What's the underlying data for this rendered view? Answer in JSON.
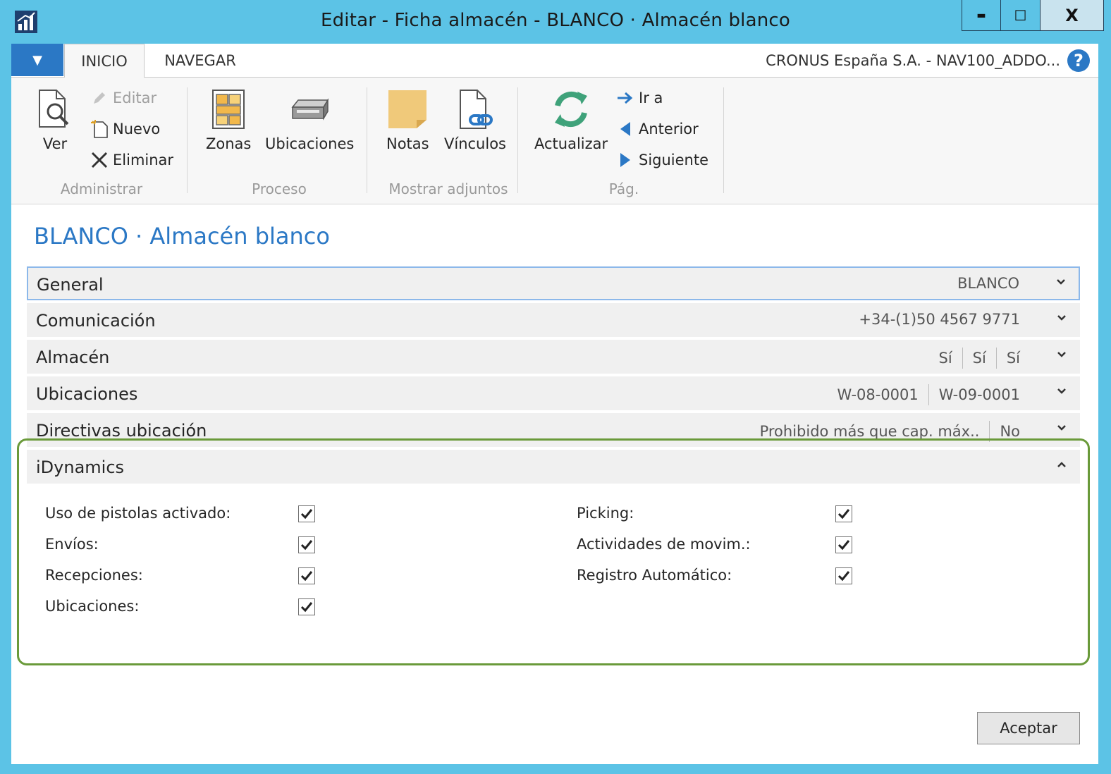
{
  "window": {
    "title": "Editar - Ficha almacén - BLANCO · Almacén blanco",
    "minimize_glyph": "▬",
    "maximize_glyph": "☐",
    "close_glyph": "X"
  },
  "tabs": {
    "file_glyph": "▼",
    "items": [
      {
        "label": "INICIO",
        "active": true
      },
      {
        "label": "NAVEGAR",
        "active": false
      }
    ],
    "company": "CRONUS España S.A. - NAV100_ADDO...",
    "help_glyph": "?"
  },
  "ribbon": {
    "groups": [
      {
        "label": "Administrar"
      },
      {
        "label": "Proceso"
      },
      {
        "label": "Mostrar adjuntos"
      },
      {
        "label": "Pág."
      }
    ],
    "ver": "Ver",
    "editar": "Editar",
    "nuevo": "Nuevo",
    "eliminar": "Eliminar",
    "zonas": "Zonas",
    "ubicaciones": "Ubicaciones",
    "notas": "Notas",
    "vinculos": "Vínculos",
    "actualizar": "Actualizar",
    "ir_a": "Ir a",
    "anterior": "Anterior",
    "siguiente": "Siguiente"
  },
  "page": {
    "title": "BLANCO · Almacén blanco"
  },
  "fasttabs": [
    {
      "title": "General",
      "summary": [
        "BLANCO"
      ],
      "expanded": false
    },
    {
      "title": "Comunicación",
      "summary": [
        "+34-(1)50 4567 9771"
      ],
      "expanded": false
    },
    {
      "title": "Almacén",
      "summary": [
        "Sí",
        "Sí",
        "Sí"
      ],
      "expanded": false
    },
    {
      "title": "Ubicaciones",
      "summary": [
        "W-08-0001",
        "W-09-0001"
      ],
      "expanded": false
    },
    {
      "title": "Directivas ubicación",
      "summary": [
        "Prohibido más que cap. máx..",
        "No"
      ],
      "expanded": false
    },
    {
      "title": "iDynamics",
      "summary": [],
      "expanded": true
    }
  ],
  "idynamics": {
    "left": [
      {
        "label": "Uso de pistolas activado:",
        "checked": true
      },
      {
        "label": "Envíos:",
        "checked": true
      },
      {
        "label": "Recepciones:",
        "checked": true
      },
      {
        "label": "Ubicaciones:",
        "checked": true
      }
    ],
    "right": [
      {
        "label": "Picking:",
        "checked": true
      },
      {
        "label": "Actividades de movim.:",
        "checked": true
      },
      {
        "label": "Registro Automático:",
        "checked": true
      }
    ]
  },
  "footer": {
    "ok_label": "Aceptar"
  },
  "colors": {
    "titlebar": "#5cc3e6",
    "accent": "#2b78c5",
    "highlight_border": "#6a9a3a"
  }
}
